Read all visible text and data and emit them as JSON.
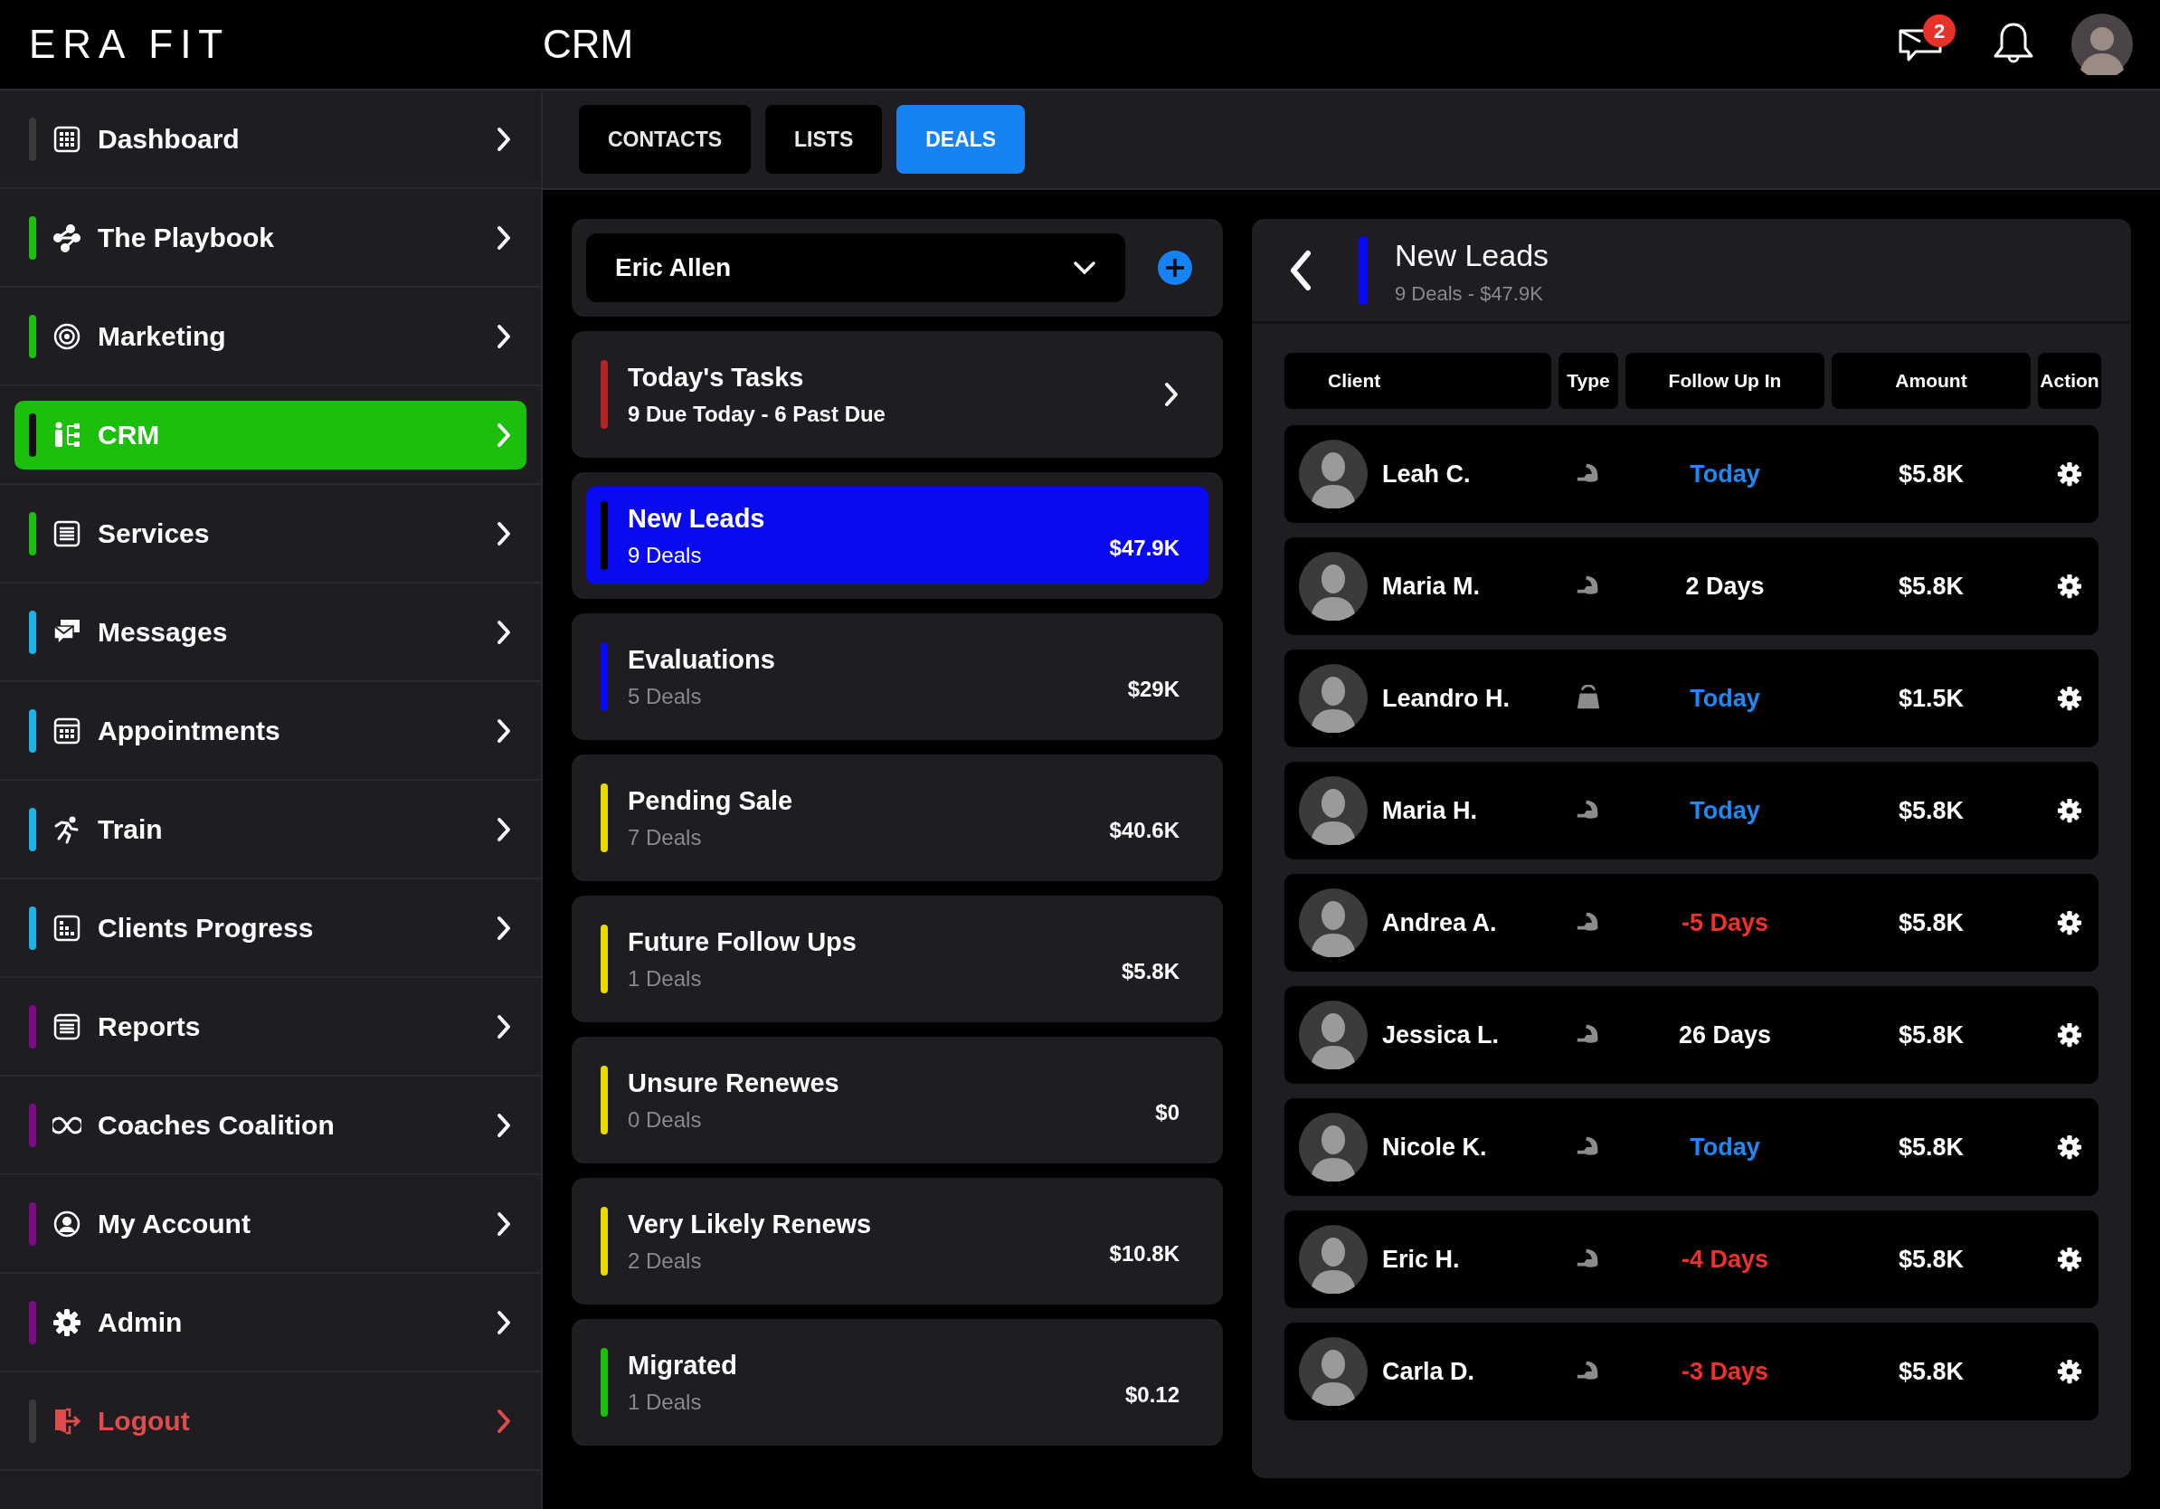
{
  "header": {
    "logo": "ERA FIT",
    "title": "CRM",
    "message_count": "2"
  },
  "sidebar": {
    "items": [
      {
        "label": "Dashboard",
        "kind": "dashboard",
        "color": "#3a3a3a",
        "selected": false
      },
      {
        "label": "The Playbook",
        "kind": "playbook",
        "color": "#1dbf0d",
        "selected": false
      },
      {
        "label": "Marketing",
        "kind": "marketing",
        "color": "#1dbf0d",
        "selected": false
      },
      {
        "label": "CRM",
        "kind": "crm",
        "color": "#1dbf0d",
        "selected": true
      },
      {
        "label": "Services",
        "kind": "services",
        "color": "#1dbf0d",
        "selected": false
      },
      {
        "label": "Messages",
        "kind": "messages",
        "color": "#1ab3ea",
        "selected": false
      },
      {
        "label": "Appointments",
        "kind": "appointments",
        "color": "#1ab3ea",
        "selected": false
      },
      {
        "label": "Train",
        "kind": "train",
        "color": "#1ab3ea",
        "selected": false
      },
      {
        "label": "Clients Progress",
        "kind": "progress",
        "color": "#1ab3ea",
        "selected": false
      },
      {
        "label": "Reports",
        "kind": "reports",
        "color": "#7b0b84",
        "selected": false
      },
      {
        "label": "Coaches Coalition",
        "kind": "coalition",
        "color": "#7b0b84",
        "selected": false
      },
      {
        "label": "My Account",
        "kind": "account",
        "color": "#7b0b84",
        "selected": false
      },
      {
        "label": "Admin",
        "kind": "admin",
        "color": "#7b0b84",
        "selected": false
      },
      {
        "label": "Logout",
        "kind": "logout",
        "color": "#3a3a3a",
        "selected": false
      }
    ]
  },
  "tabs": [
    {
      "label": "CONTACTS",
      "selected": false
    },
    {
      "label": "LISTS",
      "selected": false
    },
    {
      "label": "DEALS",
      "selected": true
    }
  ],
  "pipeline": {
    "owner": "Eric Allen",
    "cards": [
      {
        "kind": "tasks",
        "title": "Today's Tasks",
        "subtitle": "9 Due Today - 6 Past Due",
        "color": "#b52222",
        "selected": false
      },
      {
        "kind": "stage",
        "title": "New Leads",
        "subtitle": "9 Deals",
        "amount": "$47.9K",
        "color": "#0a0af0",
        "selected": true
      },
      {
        "kind": "stage",
        "title": "Evaluations",
        "subtitle": "5 Deals",
        "amount": "$29K",
        "color": "#0a0af0",
        "selected": false
      },
      {
        "kind": "stage",
        "title": "Pending Sale",
        "subtitle": "7 Deals",
        "amount": "$40.6K",
        "color": "#e6da00",
        "selected": false
      },
      {
        "kind": "stage",
        "title": "Future Follow Ups",
        "subtitle": "1 Deals",
        "amount": "$5.8K",
        "color": "#e6da00",
        "selected": false
      },
      {
        "kind": "stage",
        "title": "Unsure Renewes",
        "subtitle": "0 Deals",
        "amount": "$0",
        "color": "#e6da00",
        "selected": false
      },
      {
        "kind": "stage",
        "title": "Very Likely Renews",
        "subtitle": "2 Deals",
        "amount": "$10.8K",
        "color": "#e6da00",
        "selected": false
      },
      {
        "kind": "stage",
        "title": "Migrated",
        "subtitle": "1 Deals",
        "amount": "$0.12",
        "color": "#1dbf0d",
        "selected": false
      }
    ]
  },
  "detail": {
    "title": "New Leads",
    "subtitle": "9 Deals - $47.9K",
    "color": "#0a0af0",
    "columns": [
      "Client",
      "Type",
      "Follow Up In",
      "Amount",
      "Action"
    ],
    "rows": [
      {
        "client": "Leah C.",
        "kind": "arm",
        "follow_up": "Today",
        "color": "#1e8af5",
        "amount": "$5.8K"
      },
      {
        "client": "Maria M.",
        "kind": "arm",
        "follow_up": "2 Days",
        "color": "#ffffff",
        "amount": "$5.8K"
      },
      {
        "client": "Leandro H.",
        "kind": "weight",
        "follow_up": "Today",
        "color": "#1e8af5",
        "amount": "$1.5K"
      },
      {
        "client": "Maria H.",
        "kind": "arm",
        "follow_up": "Today",
        "color": "#1e8af5",
        "amount": "$5.8K"
      },
      {
        "client": "Andrea A.",
        "kind": "arm",
        "follow_up": "-5 Days",
        "color": "#f0302a",
        "amount": "$5.8K"
      },
      {
        "client": "Jessica L.",
        "kind": "arm",
        "follow_up": "26 Days",
        "color": "#ffffff",
        "amount": "$5.8K"
      },
      {
        "client": "Nicole K.",
        "kind": "arm",
        "follow_up": "Today",
        "color": "#1e8af5",
        "amount": "$5.8K"
      },
      {
        "client": "Eric H.",
        "kind": "arm",
        "follow_up": "-4 Days",
        "color": "#f0302a",
        "amount": "$5.8K"
      },
      {
        "client": "Carla D.",
        "kind": "arm",
        "follow_up": "-3 Days",
        "color": "#f0302a",
        "amount": "$5.8K"
      }
    ]
  }
}
